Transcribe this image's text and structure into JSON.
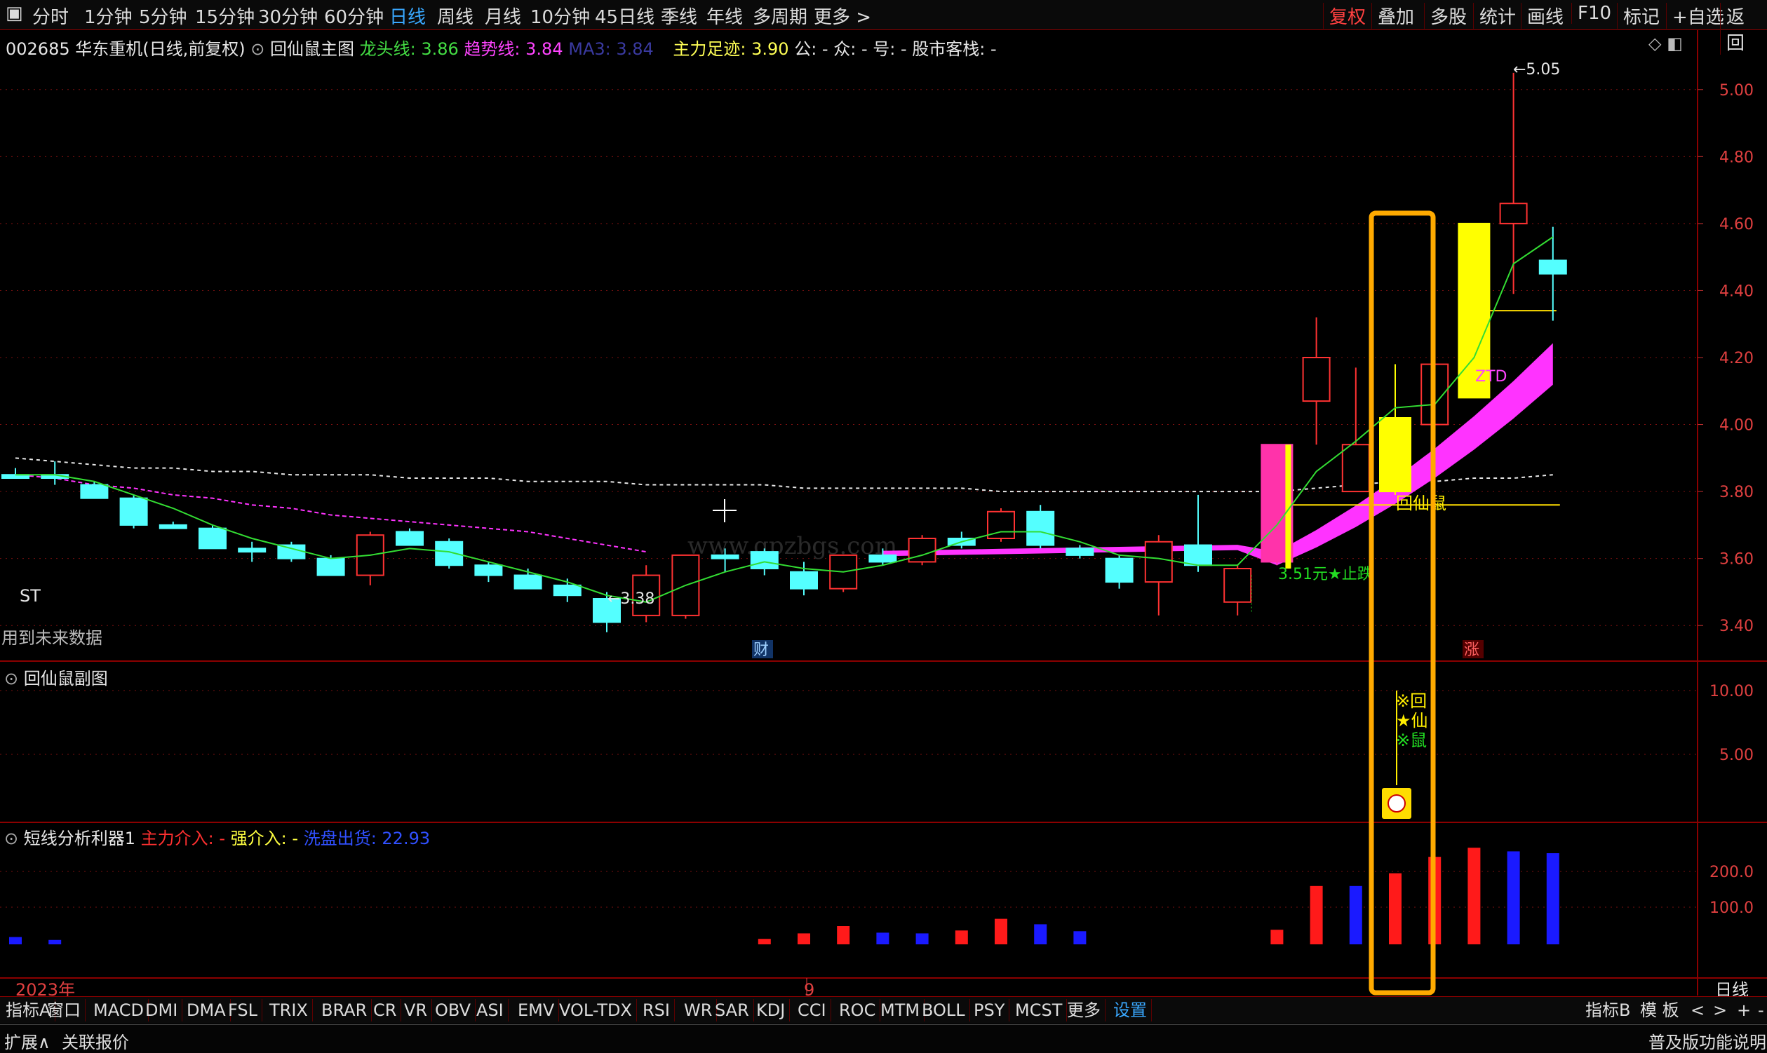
{
  "top_menu": [
    "分时",
    "1分钟",
    "5分钟",
    "15分钟",
    "30分钟",
    "60分钟",
    "日线",
    "周线",
    "月线",
    "10分钟",
    "45日线",
    "季线",
    "年线",
    "多周期",
    "更多 >"
  ],
  "top_menu_active": "日线",
  "top_right": [
    "复权",
    "叠加",
    "多股",
    "统计",
    "画线",
    "F10",
    "标记",
    "+自选",
    "返回"
  ],
  "main_header": {
    "stock": "002685 华东重机(日线,前复权)",
    "indicator": "回仙鼠主图",
    "longtou": "龙头线: 3.86",
    "qushi": "趋势线: 3.84",
    "ma3": "MA3: 3.84",
    "zhuli": "主力足迹: 3.90",
    "gong": "公: -",
    "zhong": "众: -",
    "hao": "号: -",
    "gushi": "股市客栈: -"
  },
  "sub1_header": "回仙鼠副图",
  "sub2_header": {
    "name": "短线分析利器1",
    "zhuli": "主力介入: -",
    "qiang": "强介入: -",
    "xipan": "洗盘出货: 22.93"
  },
  "annotations": {
    "st": "ST",
    "future": "用到未来数据",
    "low": "←3.38",
    "high": "←5.05",
    "stop": "3.51元★止跌",
    "huixianshu": "回仙鼠",
    "ztd": "ZTD",
    "cai": "财",
    "zhang": "涨",
    "sub1_marks": [
      "※回",
      "★仙",
      "※鼠"
    ],
    "watermark_url": "www.gpzbgs.com"
  },
  "axis": {
    "main_ticks": [
      "5.00",
      "4.80",
      "4.60",
      "4.40",
      "4.20",
      "4.00",
      "3.80",
      "3.60",
      "3.40"
    ],
    "sub1_ticks": [
      "10.00",
      "5.00"
    ],
    "sub2_ticks": [
      "200.0",
      "100.0"
    ],
    "date_labels": [
      "2023年",
      "9"
    ],
    "period_label": "日线"
  },
  "bottom_tabs": [
    "指标A",
    "窗口",
    "MACD",
    "DMI",
    "DMA",
    "FSL",
    "TRIX",
    "BRAR",
    "CR",
    "VR",
    "OBV",
    "ASI",
    "EMV",
    "VOL-TDX",
    "RSI",
    "WR",
    "SAR",
    "KDJ",
    "CCI",
    "ROC",
    "MTM",
    "BOLL",
    "PSY",
    "MCST",
    "更多",
    "设置"
  ],
  "bottom_right_tabs": [
    "指标B",
    "模 板",
    "<",
    ">",
    "+",
    "-"
  ],
  "status": {
    "left1": "扩展∧",
    "left2": "关联报价",
    "right": "普及版功能说明"
  },
  "chart_data": {
    "type": "candlestick",
    "price_range": [
      3.3,
      5.1
    ],
    "candles": [
      {
        "o": 3.85,
        "h": 3.87,
        "l": 3.84,
        "c": 3.84
      },
      {
        "o": 3.85,
        "h": 3.89,
        "l": 3.82,
        "c": 3.84
      },
      {
        "o": 3.82,
        "h": 3.83,
        "l": 3.78,
        "c": 3.78
      },
      {
        "o": 3.78,
        "h": 3.79,
        "l": 3.69,
        "c": 3.7
      },
      {
        "o": 3.7,
        "h": 3.71,
        "l": 3.69,
        "c": 3.69
      },
      {
        "o": 3.69,
        "h": 3.7,
        "l": 3.63,
        "c": 3.63
      },
      {
        "o": 3.63,
        "h": 3.65,
        "l": 3.59,
        "c": 3.62
      },
      {
        "o": 3.64,
        "h": 3.65,
        "l": 3.59,
        "c": 3.6
      },
      {
        "o": 3.6,
        "h": 3.61,
        "l": 3.55,
        "c": 3.55
      },
      {
        "o": 3.55,
        "h": 3.68,
        "l": 3.52,
        "c": 3.67
      },
      {
        "o": 3.68,
        "h": 3.69,
        "l": 3.64,
        "c": 3.64
      },
      {
        "o": 3.65,
        "h": 3.66,
        "l": 3.57,
        "c": 3.58
      },
      {
        "o": 3.58,
        "h": 3.59,
        "l": 3.53,
        "c": 3.55
      },
      {
        "o": 3.55,
        "h": 3.57,
        "l": 3.51,
        "c": 3.51
      },
      {
        "o": 3.52,
        "h": 3.54,
        "l": 3.47,
        "c": 3.49
      },
      {
        "o": 3.48,
        "h": 3.5,
        "l": 3.38,
        "c": 3.41
      },
      {
        "o": 3.43,
        "h": 3.58,
        "l": 3.41,
        "c": 3.55
      },
      {
        "o": 3.43,
        "h": 3.61,
        "l": 3.42,
        "c": 3.61
      },
      {
        "o": 3.61,
        "h": 3.63,
        "l": 3.56,
        "c": 3.6
      },
      {
        "o": 3.62,
        "h": 3.63,
        "l": 3.55,
        "c": 3.57
      },
      {
        "o": 3.56,
        "h": 3.59,
        "l": 3.49,
        "c": 3.51
      },
      {
        "o": 3.51,
        "h": 3.61,
        "l": 3.5,
        "c": 3.61
      },
      {
        "o": 3.61,
        "h": 3.63,
        "l": 3.58,
        "c": 3.59
      },
      {
        "o": 3.59,
        "h": 3.67,
        "l": 3.58,
        "c": 3.66
      },
      {
        "o": 3.66,
        "h": 3.68,
        "l": 3.63,
        "c": 3.64
      },
      {
        "o": 3.66,
        "h": 3.75,
        "l": 3.65,
        "c": 3.74
      },
      {
        "o": 3.74,
        "h": 3.76,
        "l": 3.63,
        "c": 3.64
      },
      {
        "o": 3.63,
        "h": 3.64,
        "l": 3.6,
        "c": 3.61
      },
      {
        "o": 3.6,
        "h": 3.61,
        "l": 3.51,
        "c": 3.53
      },
      {
        "o": 3.53,
        "h": 3.67,
        "l": 3.43,
        "c": 3.65
      },
      {
        "o": 3.64,
        "h": 3.79,
        "l": 3.56,
        "c": 3.58
      },
      {
        "o": 3.47,
        "h": 3.58,
        "l": 3.43,
        "c": 3.57
      },
      {
        "o": 3.59,
        "h": 3.94,
        "l": 3.58,
        "c": 3.94
      },
      {
        "o": 4.07,
        "h": 4.32,
        "l": 3.94,
        "c": 4.2
      },
      {
        "o": 3.8,
        "h": 4.17,
        "l": 3.8,
        "c": 3.94
      },
      {
        "o": 4.02,
        "h": 4.18,
        "l": 3.79,
        "c": 3.8
      },
      {
        "o": 4.0,
        "h": 4.22,
        "l": 3.99,
        "c": 4.18
      },
      {
        "o": 4.08,
        "h": 4.6,
        "l": 4.08,
        "c": 4.6
      },
      {
        "o": 4.6,
        "h": 5.05,
        "l": 4.39,
        "c": 4.66
      },
      {
        "o": 4.49,
        "h": 4.59,
        "l": 4.31,
        "c": 4.45
      }
    ],
    "lines": {
      "longtou": [
        3.85,
        3.85,
        3.83,
        3.79,
        3.75,
        3.7,
        3.66,
        3.63,
        3.6,
        3.61,
        3.63,
        3.62,
        3.59,
        3.56,
        3.53,
        3.49,
        3.47,
        3.52,
        3.56,
        3.59,
        3.57,
        3.56,
        3.58,
        3.61,
        3.65,
        3.68,
        3.68,
        3.65,
        3.61,
        3.6,
        3.58,
        3.58,
        3.7,
        3.86,
        3.95,
        4.05,
        4.06,
        4.2,
        4.48,
        4.56
      ],
      "ma_dashed_white": [
        3.9,
        3.89,
        3.88,
        3.87,
        3.87,
        3.86,
        3.86,
        3.85,
        3.85,
        3.85,
        3.84,
        3.84,
        3.84,
        3.83,
        3.83,
        3.83,
        3.82,
        3.82,
        3.82,
        3.82,
        3.81,
        3.81,
        3.81,
        3.81,
        3.81,
        3.8,
        3.8,
        3.8,
        3.8,
        3.8,
        3.8,
        3.8,
        3.8,
        3.81,
        3.82,
        3.83,
        3.83,
        3.84,
        3.84,
        3.85
      ],
      "ma_dashed_magenta": [
        3.85,
        3.84,
        3.82,
        3.81,
        3.79,
        3.78,
        3.76,
        3.75,
        3.73,
        3.72,
        3.71,
        3.7,
        3.69,
        3.68,
        3.66,
        3.64,
        3.62
      ]
    },
    "sub2_bars": [
      {
        "i": 0,
        "v": 20,
        "c": "blue"
      },
      {
        "i": 1,
        "v": 12,
        "c": "blue"
      },
      {
        "i": 19,
        "v": 15,
        "c": "red"
      },
      {
        "i": 20,
        "v": 30,
        "c": "red"
      },
      {
        "i": 21,
        "v": 50,
        "c": "red"
      },
      {
        "i": 22,
        "v": 32,
        "c": "blue"
      },
      {
        "i": 23,
        "v": 30,
        "c": "blue"
      },
      {
        "i": 24,
        "v": 38,
        "c": "red"
      },
      {
        "i": 25,
        "v": 70,
        "c": "red"
      },
      {
        "i": 26,
        "v": 55,
        "c": "blue"
      },
      {
        "i": 27,
        "v": 36,
        "c": "blue"
      },
      {
        "i": 32,
        "v": 40,
        "c": "red"
      },
      {
        "i": 33,
        "v": 160,
        "c": "red"
      },
      {
        "i": 34,
        "v": 160,
        "c": "blue"
      },
      {
        "i": 35,
        "v": 195,
        "c": "red"
      },
      {
        "i": 36,
        "v": 240,
        "c": "red"
      },
      {
        "i": 37,
        "v": 265,
        "c": "red"
      },
      {
        "i": 38,
        "v": 255,
        "c": "blue"
      },
      {
        "i": 39,
        "v": 250,
        "c": "blue"
      }
    ]
  }
}
